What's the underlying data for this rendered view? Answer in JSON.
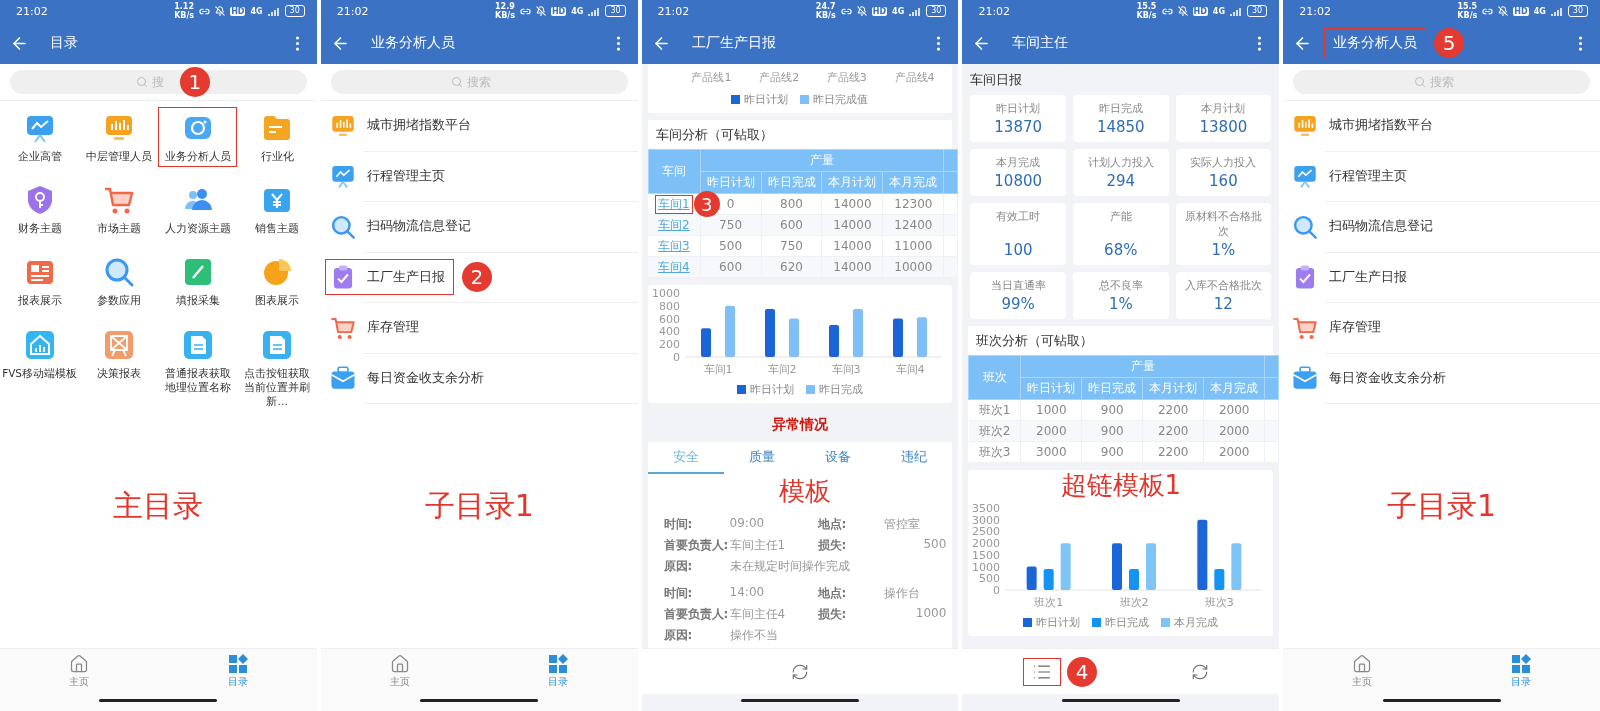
{
  "screens": [
    {
      "kind": "catalog",
      "status_bar": {
        "time": "21:02",
        "speed": "1.12",
        "speed_unit": "KB/s",
        "hd": "HD",
        "network": "4G",
        "battery": "30"
      },
      "title": "目录",
      "title_highlighted": false,
      "search": {
        "placeholder": "搜"
      },
      "items": [
        {
          "label": "企业高管",
          "highlighted": false
        },
        {
          "label": "中层管理人员",
          "highlighted": false
        },
        {
          "label": "业务分析人员",
          "highlighted": true
        },
        {
          "label": "行业化",
          "highlighted": false
        },
        {
          "label": "财务主题",
          "highlighted": false
        },
        {
          "label": "市场主题",
          "highlighted": false
        },
        {
          "label": "人力资源主题",
          "highlighted": false
        },
        {
          "label": "销售主题",
          "highlighted": false
        },
        {
          "label": "报表展示",
          "highlighted": false
        },
        {
          "label": "参数应用",
          "highlighted": false
        },
        {
          "label": "填报采集",
          "highlighted": false
        },
        {
          "label": "图表展示",
          "highlighted": false
        },
        {
          "label": "FVS移动端模板",
          "highlighted": false
        },
        {
          "label": "决策报表",
          "highlighted": false
        },
        {
          "label": "普通报表获取地理位置名称",
          "highlighted": false
        },
        {
          "label": "点击按钮获取当前位置并刷新…",
          "highlighted": false
        }
      ],
      "nav": [
        {
          "label": "主页",
          "selected": false
        },
        {
          "label": "目录",
          "selected": true
        }
      ],
      "callout": "1",
      "caption": "主目录"
    },
    {
      "kind": "list",
      "status_bar": {
        "time": "21:02",
        "speed": "12.9",
        "speed_unit": "KB/s",
        "hd": "HD",
        "network": "4G",
        "battery": "30"
      },
      "title": "业务分析人员",
      "title_highlighted": false,
      "search": {
        "placeholder": "搜索"
      },
      "items": [
        {
          "label": "城市拥堵指数平台",
          "highlighted": false
        },
        {
          "label": "行程管理主页",
          "highlighted": false
        },
        {
          "label": "扫码物流信息登记",
          "highlighted": false
        },
        {
          "label": "工厂生产日报",
          "highlighted": true
        },
        {
          "label": "库存管理",
          "highlighted": false
        },
        {
          "label": "每日资金收支余分析",
          "highlighted": false
        }
      ],
      "nav": [
        {
          "label": "主页",
          "selected": false
        },
        {
          "label": "目录",
          "selected": true
        }
      ],
      "callout": "2",
      "caption": "子目录1"
    },
    {
      "kind": "report",
      "status_bar": {
        "time": "21:02",
        "speed": "24.7",
        "speed_unit": "KB/s",
        "hd": "HD",
        "network": "4G",
        "battery": "30"
      },
      "title": "工厂生产日报",
      "title_highlighted": false,
      "top_chart": {
        "categories": [
          "产品线1",
          "产品线2",
          "产品线3",
          "产品线4"
        ],
        "legend": [
          {
            "label": "昨日计划",
            "color": "#1a66d9"
          },
          {
            "label": "昨日完成值",
            "color": "#7fbff5"
          }
        ]
      },
      "section_title": "车间分析（可钻取）",
      "table": {
        "links": true,
        "corner": "车间",
        "group": "产量",
        "columns": [
          "昨日计划",
          "昨日完成",
          "本月计划",
          "本月完成"
        ],
        "rows": [
          {
            "label": "车间1",
            "values": [
              "0",
              "800",
              "14000",
              "12300"
            ],
            "highlighted": true
          },
          {
            "label": "车间2",
            "values": [
              "750",
              "600",
              "14000",
              "12400"
            ],
            "highlighted": false
          },
          {
            "label": "车间3",
            "values": [
              "500",
              "750",
              "14000",
              "11000"
            ],
            "highlighted": false
          },
          {
            "label": "车间4",
            "values": [
              "600",
              "620",
              "14000",
              "10000"
            ],
            "highlighted": false
          }
        ]
      },
      "chart": {
        "chart_data": {
          "type": "bar",
          "legend": "bottom",
          "categories": [
            "车间1",
            "车间2",
            "车间3",
            "车间4"
          ],
          "ylim": [
            0,
            1000
          ],
          "yticks": [
            0,
            200,
            400,
            600,
            800,
            1000
          ],
          "series": [
            {
              "name": "昨日计划",
              "color": "#1a66d9",
              "values": [
                450,
                750,
                500,
                600
              ]
            },
            {
              "name": "昨日完成",
              "color": "#7fbff5",
              "values": [
                800,
                600,
                750,
                620
              ]
            }
          ]
        }
      },
      "alert": {
        "title": "异常情况",
        "tabs": [
          {
            "label": "安全",
            "selected": true
          },
          {
            "label": "质量",
            "selected": false
          },
          {
            "label": "设备",
            "selected": false
          },
          {
            "label": "违纪",
            "selected": false
          }
        ],
        "records": [
          {
            "fields": [
              {
                "label": "时间:",
                "value": "09:00"
              },
              {
                "label": "地点:",
                "value": "管控室"
              },
              {
                "label": "首要负责人:",
                "value": "车间主任1"
              },
              {
                "label": "损失:",
                "value": "500"
              },
              {
                "label": "原因:",
                "value": "未在规定时间操作完成"
              }
            ]
          },
          {
            "fields": [
              {
                "label": "时间:",
                "value": "14:00"
              },
              {
                "label": "地点:",
                "value": "操作台"
              },
              {
                "label": "首要负责人:",
                "value": "车间主任4"
              },
              {
                "label": "损失:",
                "value": "1000"
              },
              {
                "label": "原因:",
                "value": "操作不当"
              }
            ]
          }
        ]
      },
      "footer_buttons": [
        {
          "kind": "refresh",
          "highlighted": false
        }
      ],
      "callout": "3",
      "caption": "模板"
    },
    {
      "kind": "dashboard",
      "status_bar": {
        "time": "21:02",
        "speed": "15.5",
        "speed_unit": "KB/s",
        "hd": "HD",
        "network": "4G",
        "battery": "30"
      },
      "title": "车间主任",
      "title_highlighted": false,
      "section_title": "车间日报",
      "kpis": [
        {
          "label": "昨日计划",
          "value": "13870"
        },
        {
          "label": "昨日完成",
          "value": "14850"
        },
        {
          "label": "本月计划",
          "value": "13800"
        },
        {
          "label": "本月完成",
          "value": "10800"
        },
        {
          "label": "计划人力投入",
          "value": "294"
        },
        {
          "label": "实际人力投入",
          "value": "160"
        },
        {
          "label": "有效工时",
          "value": "100"
        },
        {
          "label": "产能",
          "value": "68%"
        },
        {
          "label": "原材料不合格批次",
          "value": "1%"
        },
        {
          "label": "当日直通率",
          "value": "99%"
        },
        {
          "label": "总不良率",
          "value": "1%"
        },
        {
          "label": "入库不合格批次",
          "value": "12"
        }
      ],
      "table_title": "班次分析（可钻取）",
      "table": {
        "links": false,
        "corner": "班次",
        "group": "产量",
        "columns": [
          "昨日计划",
          "昨日完成",
          "本月计划",
          "本月完成"
        ],
        "rows": [
          {
            "label": "班次1",
            "values": [
              "1000",
              "900",
              "2200",
              "2000"
            ]
          },
          {
            "label": "班次2",
            "values": [
              "2000",
              "900",
              "2200",
              "2000"
            ]
          },
          {
            "label": "班次3",
            "values": [
              "3000",
              "900",
              "2200",
              "2000"
            ]
          }
        ]
      },
      "chart": {
        "chart_data": {
          "type": "bar",
          "legend": "bottom",
          "categories": [
            "班次1",
            "班次2",
            "班次3"
          ],
          "ylim": [
            0,
            3500
          ],
          "yticks": [
            0,
            500,
            1000,
            1500,
            2000,
            2500,
            3000,
            3500
          ],
          "series": [
            {
              "name": "昨日计划",
              "color": "#1a66d9",
              "values": [
                1000,
                2000,
                3000
              ]
            },
            {
              "name": "昨日完成",
              "color": "#1493f5",
              "values": [
                900,
                900,
                900
              ]
            },
            {
              "name": "本月完成",
              "color": "#7fc4f7",
              "values": [
                2000,
                2000,
                2000
              ]
            }
          ]
        }
      },
      "footer_buttons": [
        {
          "kind": "menu",
          "highlighted": true
        },
        {
          "kind": "refresh",
          "highlighted": false
        }
      ],
      "callout": "4",
      "caption": "超链模板1"
    },
    {
      "kind": "list",
      "status_bar": {
        "time": "21:02",
        "speed": "15.5",
        "speed_unit": "KB/s",
        "hd": "HD",
        "network": "4G",
        "battery": "30"
      },
      "title": "业务分析人员",
      "title_highlighted": true,
      "search": {
        "placeholder": "搜索"
      },
      "items": [
        {
          "label": "城市拥堵指数平台",
          "highlighted": false
        },
        {
          "label": "行程管理主页",
          "highlighted": false
        },
        {
          "label": "扫码物流信息登记",
          "highlighted": false
        },
        {
          "label": "工厂生产日报",
          "highlighted": false
        },
        {
          "label": "库存管理",
          "highlighted": false
        },
        {
          "label": "每日资金收支余分析",
          "highlighted": false
        }
      ],
      "nav": [
        {
          "label": "主页",
          "selected": false
        },
        {
          "label": "目录",
          "selected": true
        }
      ],
      "callout": "5",
      "caption": "子目录1"
    }
  ]
}
